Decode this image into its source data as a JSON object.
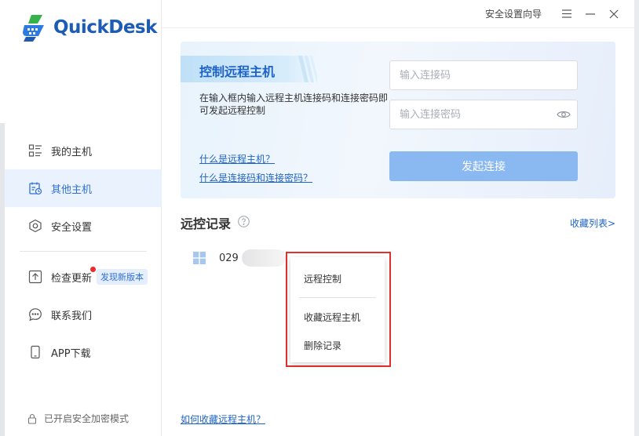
{
  "app": {
    "name": "QuickDesk",
    "brand_color": "#1c5bb6",
    "accent_color": "#2f6fd8"
  },
  "titlebar": {
    "security_wizard": "安全设置向导",
    "menu_icon": "hamburger-icon",
    "minimize_icon": "minimize-icon",
    "close_icon": "close-icon"
  },
  "sidebar": {
    "items": [
      {
        "label": "我的主机",
        "icon": "hosts-list-icon",
        "active": false
      },
      {
        "label": "其他主机",
        "icon": "remote-calendar-icon",
        "active": true
      },
      {
        "label": "安全设置",
        "icon": "shield-hexagon-icon",
        "active": false
      },
      {
        "label": "检查更新",
        "icon": "upload-icon",
        "active": false,
        "badge": "发现新版本",
        "has_dot": true
      },
      {
        "label": "联系我们",
        "icon": "chat-bubble-icon",
        "active": false
      },
      {
        "label": "APP下载",
        "icon": "phone-icon",
        "active": false
      }
    ],
    "footer": "已开启安全加密模式"
  },
  "connect_panel": {
    "title": "控制远程主机",
    "description": "在输入框内输入远程主机连接码和连接密码即可发起远程控制",
    "link_what_is_remote": "什么是远程主机？",
    "link_what_is_code": "什么是连接码和连接密码？",
    "code_placeholder": "输入连接码",
    "password_placeholder": "输入连接密码",
    "connect_button": "发起连接"
  },
  "records": {
    "title": "远控记录",
    "favorites_link": "收藏列表>",
    "items": [
      {
        "id_prefix": "029",
        "os_icon": "windows-icon"
      }
    ],
    "how_to_favorite": "如何收藏远程主机？"
  },
  "context_menu": {
    "items": [
      "远程控制",
      "收藏远程主机",
      "删除记录"
    ],
    "highlight_color": "#e0312c"
  }
}
